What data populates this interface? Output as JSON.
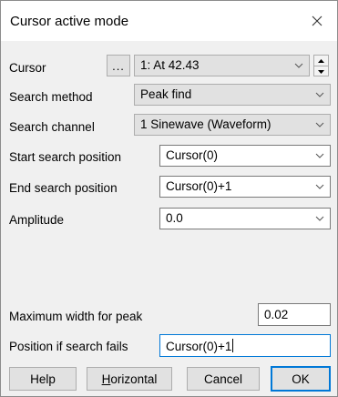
{
  "window": {
    "title": "Cursor active mode"
  },
  "cursor": {
    "label": "Cursor",
    "ellipsis_label": "...",
    "value": "1: At 42.43"
  },
  "search_method": {
    "label": "Search method",
    "value": "Peak find"
  },
  "search_channel": {
    "label": "Search channel",
    "value": "1 Sinewave (Waveform)"
  },
  "start_search": {
    "label": "Start search position",
    "value": "Cursor(0)"
  },
  "end_search": {
    "label": "End search position",
    "value": "Cursor(0)+1"
  },
  "amplitude": {
    "label": "Amplitude",
    "value": "0.0"
  },
  "max_width": {
    "label": "Maximum width for peak",
    "value": "0.02"
  },
  "position_if_fails": {
    "label": "Position if search fails",
    "value": "Cursor(0)+1"
  },
  "buttons": {
    "help": "Help",
    "horizontal_mnemonic": "H",
    "horizontal_rest": "orizontal",
    "cancel": "Cancel",
    "ok": "OK"
  },
  "colors": {
    "accent": "#0078d7",
    "dialog_bg": "#f0f0f0",
    "button_bg": "#e1e1e1"
  }
}
